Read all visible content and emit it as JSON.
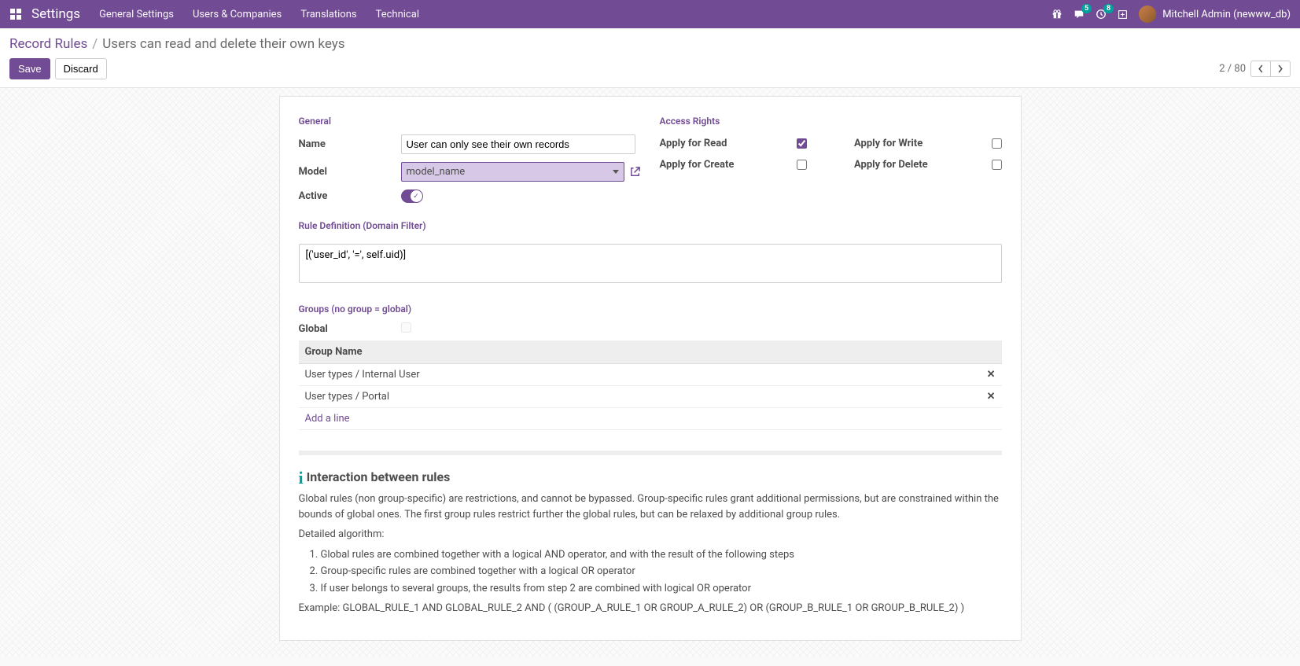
{
  "header": {
    "app_title": "Settings",
    "menu": [
      "General Settings",
      "Users & Companies",
      "Translations",
      "Technical"
    ],
    "messages_badge": "5",
    "activities_badge": "8",
    "user_name": "Mitchell Admin (newww_db)"
  },
  "breadcrumb": {
    "root": "Record Rules",
    "current": "Users can read and delete their own keys"
  },
  "actions": {
    "save": "Save",
    "discard": "Discard",
    "pager": "2 / 80"
  },
  "sections": {
    "general": "General",
    "access_rights": "Access Rights",
    "rule_def": "Rule Definition (Domain Filter)",
    "groups": "Groups (no group = global)"
  },
  "general": {
    "name_label": "Name",
    "name_value": "User can only see their own records",
    "model_label": "Model",
    "model_value": "model_name",
    "active_label": "Active"
  },
  "access": {
    "read_label": "Apply for Read",
    "write_label": "Apply for Write",
    "create_label": "Apply for Create",
    "delete_label": "Apply for Delete"
  },
  "domain_value": "[('user_id', '=', self.uid)]",
  "groups_table": {
    "global_label": "Global",
    "header": "Group Name",
    "rows": [
      "User types / Internal User",
      "User types / Portal"
    ],
    "add_line": "Add a line"
  },
  "info": {
    "title": "Interaction between rules",
    "p1": "Global rules (non group-specific) are restrictions, and cannot be bypassed. Group-specific rules grant additional permissions, but are constrained within the bounds of global ones. The first group rules restrict further the global rules, but can be relaxed by additional group rules.",
    "algo_label": "Detailed algorithm:",
    "li1": "Global rules are combined together with a logical AND operator, and with the result of the following steps",
    "li2": "Group-specific rules are combined together with a logical OR operator",
    "li3": "If user belongs to several groups, the results from step 2 are combined with logical OR operator",
    "example": "Example: GLOBAL_RULE_1 AND GLOBAL_RULE_2 AND ( (GROUP_A_RULE_1 OR GROUP_A_RULE_2) OR (GROUP_B_RULE_1 OR GROUP_B_RULE_2) )"
  }
}
